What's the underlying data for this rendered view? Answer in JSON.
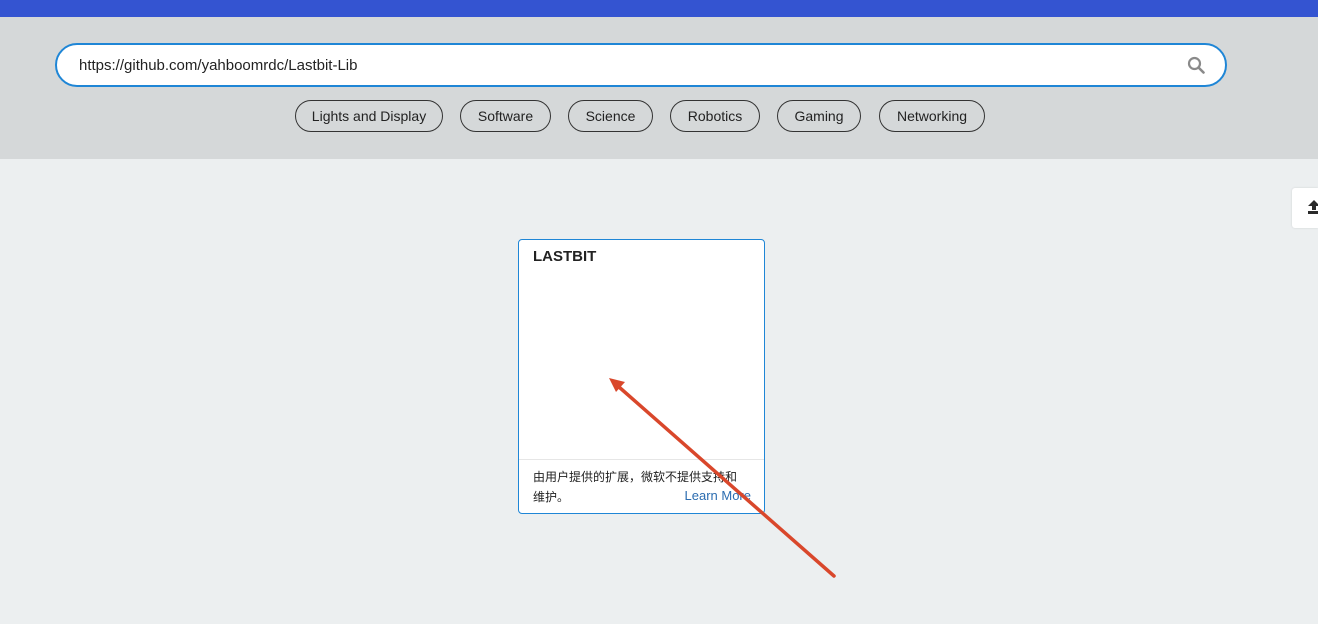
{
  "search": {
    "value": "https://github.com/yahboomrdc/Lastbit-Lib",
    "placeholder": ""
  },
  "categories": [
    "Lights and Display",
    "Software",
    "Science",
    "Robotics",
    "Gaming",
    "Networking"
  ],
  "card": {
    "title": "LASTBIT",
    "description": "由用户提供的扩展，微软不提供支持和维护。",
    "learn_more": "Learn More"
  },
  "colors": {
    "top_bar": "#3454d1",
    "header_bg": "#d5d8d9",
    "page_bg": "#eceff0",
    "accent_border": "#1f86d6",
    "link": "#2b6cb0",
    "annotation_arrow": "#d9472b"
  }
}
